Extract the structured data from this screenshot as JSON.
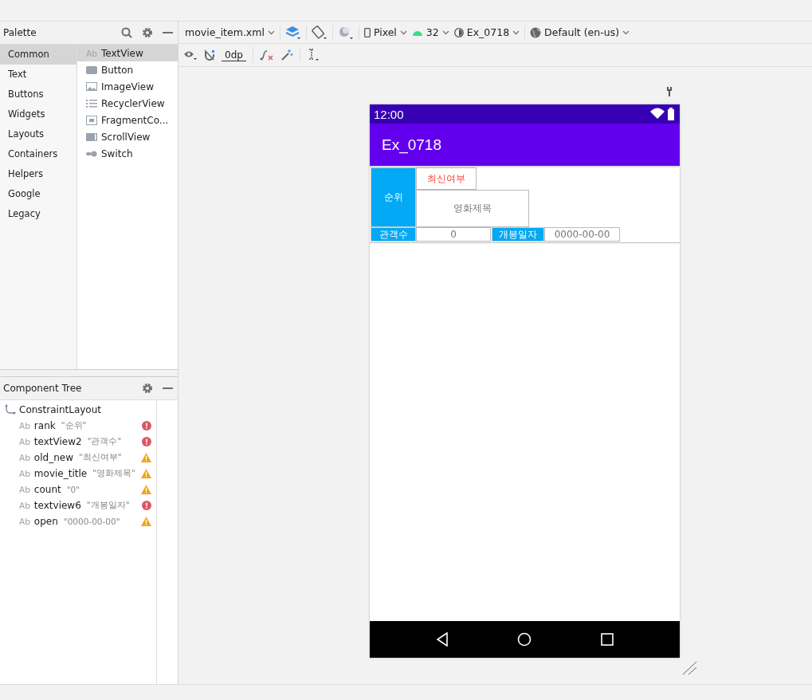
{
  "palette": {
    "title": "Palette",
    "categories": [
      {
        "label": "Common",
        "selected": true
      },
      {
        "label": "Text",
        "selected": false
      },
      {
        "label": "Buttons",
        "selected": false
      },
      {
        "label": "Widgets",
        "selected": false
      },
      {
        "label": "Layouts",
        "selected": false
      },
      {
        "label": "Containers",
        "selected": false
      },
      {
        "label": "Helpers",
        "selected": false
      },
      {
        "label": "Google",
        "selected": false
      },
      {
        "label": "Legacy",
        "selected": false
      }
    ],
    "items": [
      {
        "kind": "text",
        "icon_text": "Ab",
        "label": "TextView",
        "selected": true
      },
      {
        "kind": "button",
        "label": "Button",
        "selected": false
      },
      {
        "kind": "image",
        "label": "ImageView",
        "selected": false
      },
      {
        "kind": "list",
        "label": "RecyclerView",
        "selected": false
      },
      {
        "kind": "fragment",
        "label": "FragmentCo...",
        "selected": false
      },
      {
        "kind": "scroll",
        "label": "ScrollView",
        "selected": false
      },
      {
        "kind": "switch",
        "label": "Switch",
        "selected": false
      }
    ]
  },
  "component_tree": {
    "title": "Component Tree",
    "root": {
      "label": "ConstraintLayout",
      "children": [
        {
          "icon_text": "Ab",
          "name": "rank",
          "text": "\"순위\"",
          "kind": "error"
        },
        {
          "icon_text": "Ab",
          "name": "textView2",
          "text": "\"관객수\"",
          "kind": "error"
        },
        {
          "icon_text": "Ab",
          "name": "old_new",
          "text": "\"최신여부\"",
          "kind": "warning"
        },
        {
          "icon_text": "Ab",
          "name": "movie_title",
          "text": "\"영화제목\"",
          "kind": "warning"
        },
        {
          "icon_text": "Ab",
          "name": "count",
          "text": "\"0\"",
          "kind": "warning"
        },
        {
          "icon_text": "Ab",
          "name": "textview6",
          "text": "\"개봉일자\"",
          "kind": "error"
        },
        {
          "icon_text": "Ab",
          "name": "open",
          "text": "\"0000-00-00\"",
          "kind": "warning"
        }
      ]
    }
  },
  "toolbar": {
    "file": "movie_item.xml",
    "device": "Pixel",
    "api": "32",
    "theme": "Ex_0718",
    "locale": "Default (en-us)",
    "margin": "0dp"
  },
  "device": {
    "status_time": "12:00",
    "app_title": "Ex_0718",
    "rank": "순위",
    "old_new": "최신여부",
    "movie_title": "영화제목",
    "count_label": "관객수",
    "count": "0",
    "open_label": "개봉일자",
    "open": "0000-00-00"
  }
}
